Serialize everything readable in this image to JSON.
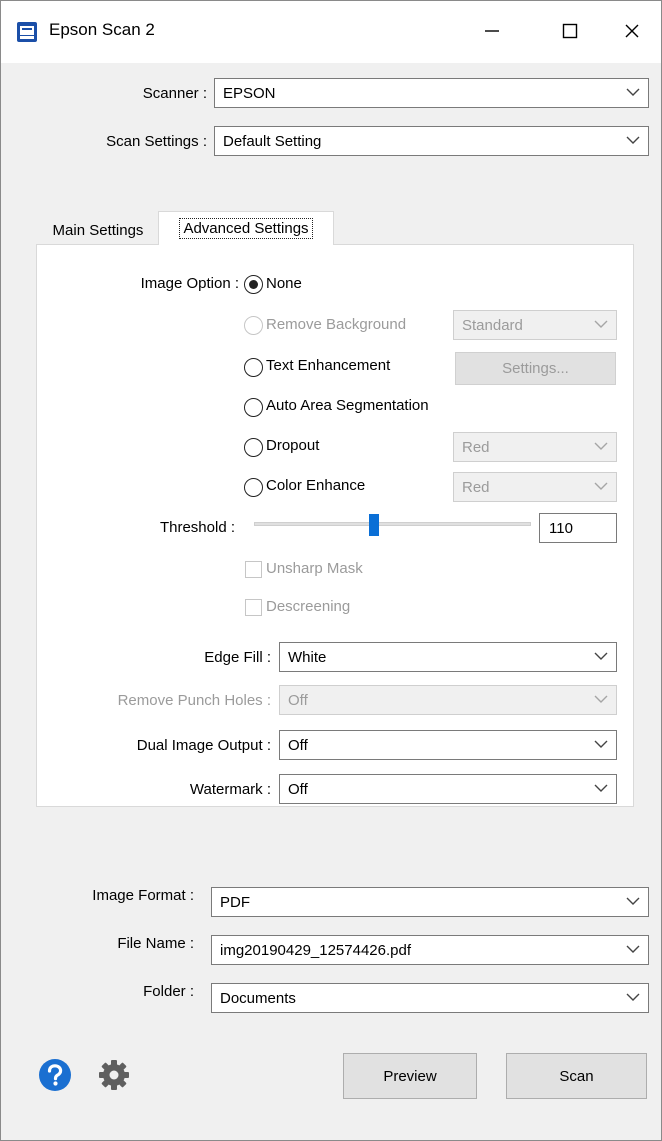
{
  "window": {
    "title": "Epson Scan 2"
  },
  "scanner": {
    "label": "Scanner :",
    "value": "EPSON"
  },
  "scan_settings": {
    "label": "Scan Settings :",
    "value": "Default Setting"
  },
  "tabs": [
    {
      "label": "Main Settings",
      "active": false
    },
    {
      "label": "Advanced Settings",
      "active": true
    }
  ],
  "image_option": {
    "label": "Image Option :",
    "options": [
      {
        "label": "None",
        "checked": true,
        "enabled": true
      },
      {
        "label": "Remove Background",
        "checked": false,
        "enabled": false,
        "select": "Standard"
      },
      {
        "label": "Text Enhancement",
        "checked": false,
        "enabled": true,
        "button": "Settings..."
      },
      {
        "label": "Auto Area Segmentation",
        "checked": false,
        "enabled": true
      },
      {
        "label": "Dropout",
        "checked": false,
        "enabled": true,
        "select": "Red"
      },
      {
        "label": "Color Enhance",
        "checked": false,
        "enabled": true,
        "select": "Red"
      }
    ]
  },
  "threshold": {
    "label": "Threshold :",
    "value": "110",
    "min": 0,
    "max": 255
  },
  "checkboxes": [
    {
      "label": "Unsharp Mask",
      "checked": false
    },
    {
      "label": "Descreening",
      "checked": false
    }
  ],
  "edge_fill": {
    "label": "Edge Fill :",
    "value": "White"
  },
  "remove_punch_holes": {
    "label": "Remove Punch Holes :",
    "value": "Off"
  },
  "dual_image_output": {
    "label": "Dual Image Output :",
    "value": "Off"
  },
  "watermark": {
    "label": "Watermark :",
    "value": "Off"
  },
  "image_format": {
    "label": "Image Format :",
    "value": "PDF"
  },
  "file_name": {
    "label": "File Name :",
    "value": "img20190429_12574426.pdf"
  },
  "folder": {
    "label": "Folder :",
    "value": "Documents"
  },
  "buttons": {
    "preview": "Preview",
    "scan": "Scan"
  },
  "colors": {
    "accent": "#0a6fd6",
    "help_icon": "#1a6fd1",
    "gear_icon": "#5f5f5f"
  }
}
